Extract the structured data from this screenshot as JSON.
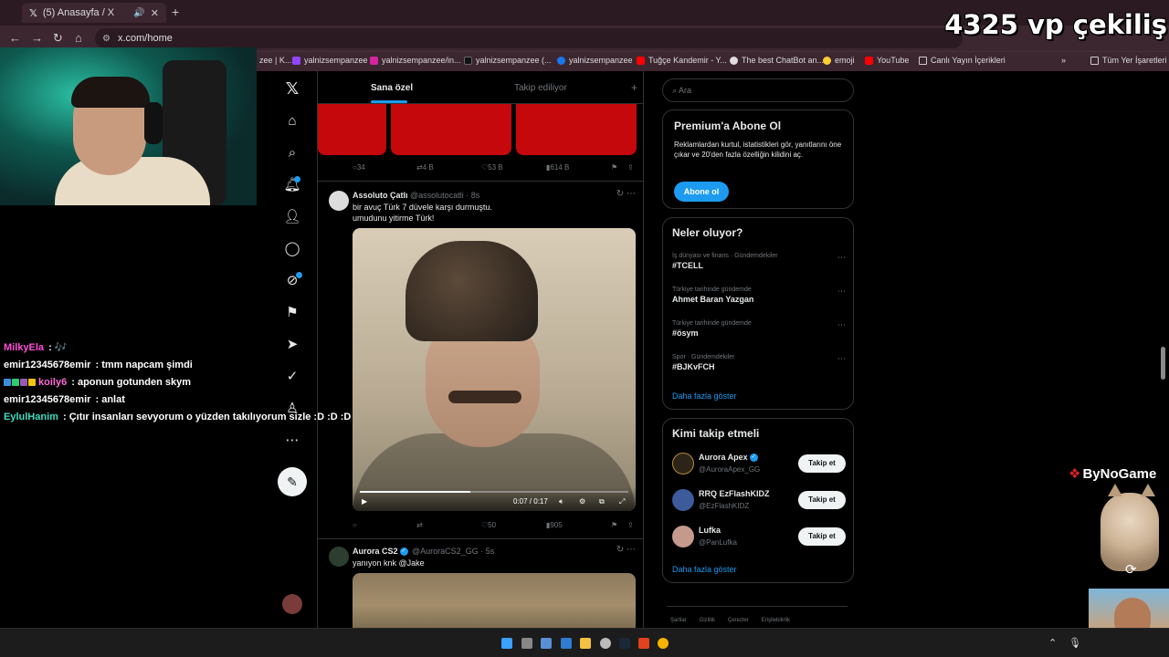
{
  "browser": {
    "tab_title": "(5) Anasayfa / X",
    "url": "x.com/home",
    "bookmarks": [
      "zee | K...",
      "yalnizsempanzee",
      "yalnizsempanzee/in...",
      "yalnizsempanzee (...",
      "yalnizsempanzee",
      "Tuğçe Kandemir - Y...",
      "The best ChatBot an...",
      "emoji",
      "YouTube",
      "Canlı Yayın İçerikleri"
    ],
    "all_bookmarks": "Tüm Yer İşaretleri"
  },
  "overlay": {
    "title": "4325 vp çekiliş",
    "sponsor": "ByNoGame"
  },
  "chat": [
    {
      "user": "MilkyEla",
      "sep": " : ",
      "msg": "🎶",
      "color": "#ff4fd8"
    },
    {
      "user": "emir12345678emir",
      "sep": " : ",
      "msg": "tmm napcam şimdi",
      "color": "#ffffff"
    },
    {
      "user": "koily6",
      "sep": " : ",
      "msg": "aponun gotunden skym",
      "color": "#ff6ad5"
    },
    {
      "user": "emir12345678emir",
      "sep": " : ",
      "msg": "anlat",
      "color": "#ffffff"
    },
    {
      "user": "EylulHanim",
      "sep": " : ",
      "msg": "Çıtır insanları sevyorum o yüzden takılıyorum sizle :D :D :D",
      "color": "#3fdcc0"
    }
  ],
  "feed": {
    "tabs": [
      "Sana özel",
      "Takip ediliyor"
    ],
    "first_actions": {
      "replies": "34",
      "reposts": "4 B",
      "likes": "53 B",
      "views": "614 B"
    },
    "tweets": [
      {
        "name": "Assoluto Çatlı",
        "handle": "@assolutocatli · 8s",
        "text_1": "bir avuç Türk 7 düvele karşı durmuştu.",
        "text_2": "umudunu yitirme Türk!",
        "video_time": "0:07 / 0:17",
        "video_progress": 0.41,
        "likes": "50",
        "views": "905"
      },
      {
        "name": "Aurora CS2",
        "handle": "@AuroraCS2_GG · 5s",
        "text_1": "yanıyon knk @Jake"
      }
    ]
  },
  "sidebar": {
    "search_placeholder": "Ara",
    "premium": {
      "title": "Premium'a Abone Ol",
      "text": "Reklamlardan kurtul, istatistikleri gör, yanıtlarını öne çıkar ve 20'den fazla özelliğin kilidini aç.",
      "button": "Abone ol"
    },
    "trends_title": "Neler oluyor?",
    "trends": [
      {
        "category": "İş dünyası ve finans · Gündemdekiler",
        "name": "#TCELL"
      },
      {
        "category": "Türkiye tarihinde gündemde",
        "name": "Ahmet Baran Yazgan"
      },
      {
        "category": "Türkiye tarihinde gündemde",
        "name": "#ösym"
      },
      {
        "category": "Spor · Gündemdekiler",
        "name": "#BJKvFCH"
      }
    ],
    "show_more": "Daha fazla göster",
    "who_to_follow_title": "Kimi takip etmeli",
    "suggestions": [
      {
        "name": "Aurora Apex",
        "handle": "@AuroraApex_GG"
      },
      {
        "name": "RRQ EzFlashKIDZ",
        "handle": "@EzFlashKIDZ"
      },
      {
        "name": "Lufka",
        "handle": "@PanLufka"
      }
    ],
    "follow_label": "Takip et",
    "footer": [
      "Şartlar",
      "Gizlilik",
      "Çerezler",
      "Erişilebilirlik"
    ]
  }
}
